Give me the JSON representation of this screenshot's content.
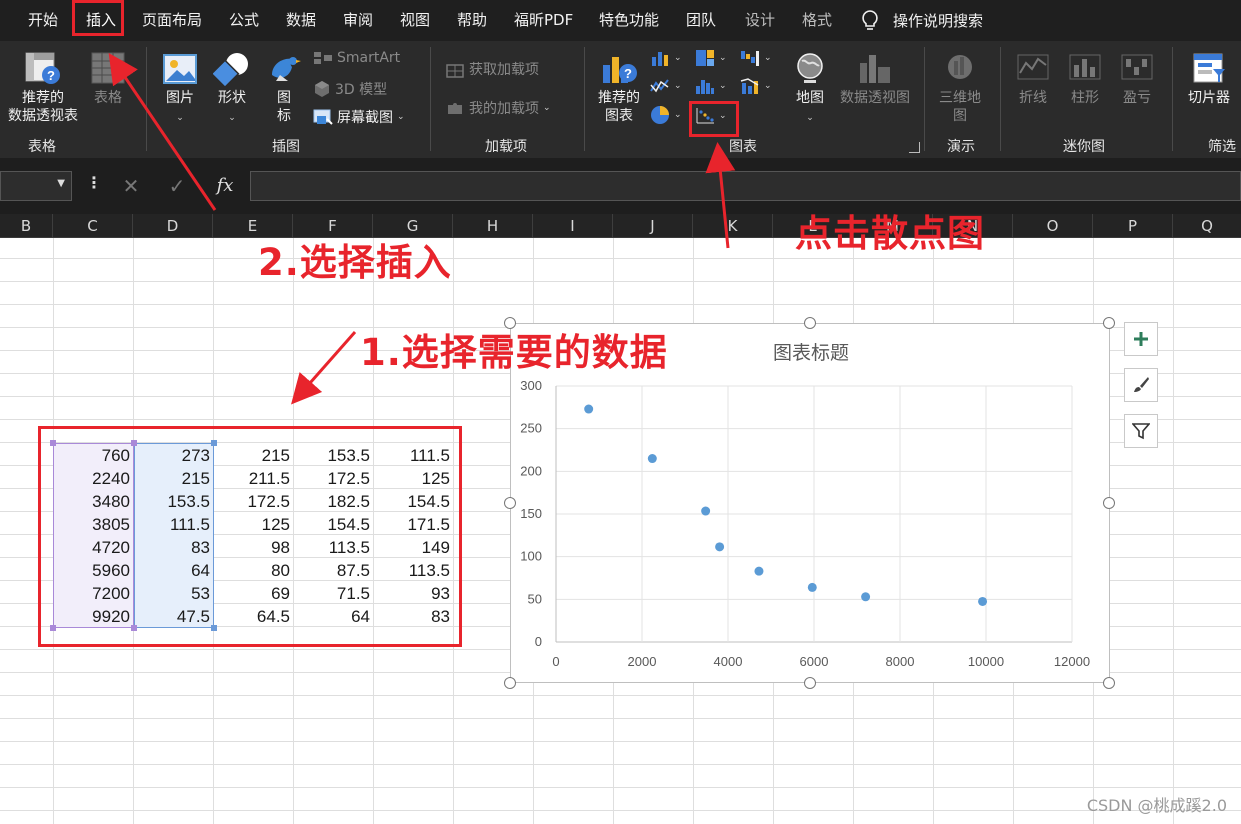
{
  "tabs": [
    "开始",
    "插入",
    "页面布局",
    "公式",
    "数据",
    "审阅",
    "视图",
    "帮助",
    "福昕PDF",
    "特色功能",
    "团队",
    "设计",
    "格式"
  ],
  "tell_me": "操作说明搜索",
  "ribbon": {
    "tables": {
      "recommended_pivot_l1": "推荐的",
      "recommended_pivot_l2": "数据透视表",
      "table": "表格",
      "group": "表格"
    },
    "illustrations": {
      "pictures": "图片",
      "shapes": "形状",
      "icons_l1": "图",
      "icons_l2": "标",
      "smartart": "SmartArt",
      "model3d": "3D 模型",
      "screenshot": "屏幕截图",
      "group": "插图"
    },
    "addins": {
      "get": "获取加载项",
      "my": "我的加载项",
      "group": "加载项"
    },
    "charts": {
      "recommended_l1": "推荐的",
      "recommended_l2": "图表",
      "map": "地图",
      "pivot_chart": "数据透视图",
      "group": "图表"
    },
    "tours": {
      "map3d_l1": "三维地",
      "map3d_l2": "图",
      "group": "演示"
    },
    "sparklines": {
      "line": "折线",
      "column": "柱形",
      "winloss": "盈亏",
      "group": "迷你图"
    },
    "filters": {
      "slicer": "切片器",
      "group": "筛选"
    }
  },
  "columns": [
    "B",
    "C",
    "D",
    "E",
    "F",
    "G",
    "H",
    "I",
    "J",
    "K",
    "L",
    "M",
    "N",
    "O",
    "P",
    "Q"
  ],
  "table": {
    "rows": [
      [
        "760",
        "273",
        "215",
        "153.5",
        "111.5"
      ],
      [
        "2240",
        "215",
        "211.5",
        "172.5",
        "125"
      ],
      [
        "3480",
        "153.5",
        "172.5",
        "182.5",
        "154.5"
      ],
      [
        "3805",
        "111.5",
        "125",
        "154.5",
        "171.5"
      ],
      [
        "4720",
        "83",
        "98",
        "113.5",
        "149"
      ],
      [
        "5960",
        "64",
        "80",
        "87.5",
        "113.5"
      ],
      [
        "7200",
        "53",
        "69",
        "71.5",
        "93"
      ],
      [
        "9920",
        "47.5",
        "64.5",
        "64",
        "83"
      ]
    ]
  },
  "chart_data": {
    "type": "scatter",
    "title": "图表标题",
    "x": [
      760,
      2240,
      3480,
      3805,
      4720,
      5960,
      7200,
      9920
    ],
    "y": [
      273,
      215,
      153.5,
      111.5,
      83,
      64,
      53,
      47.5
    ],
    "xlim": [
      0,
      12000
    ],
    "ylim": [
      0,
      300
    ],
    "xticks": [
      "0",
      "2000",
      "4000",
      "6000",
      "8000",
      "10000",
      "12000"
    ],
    "yticks": [
      "0",
      "50",
      "100",
      "150",
      "200",
      "250",
      "300"
    ],
    "grid": true,
    "marker_color": "#5b9bd5"
  },
  "annotations": {
    "step1": "1.选择需要的数据",
    "step2": "2.选择插入",
    "step3": "点击散点图"
  },
  "watermark": "CSDN @桃成蹊2.0",
  "colors": {
    "accent_red": "#e8242c",
    "ribbon_bg": "#2b2b2b",
    "tabs_bg": "#1f1f1f"
  }
}
